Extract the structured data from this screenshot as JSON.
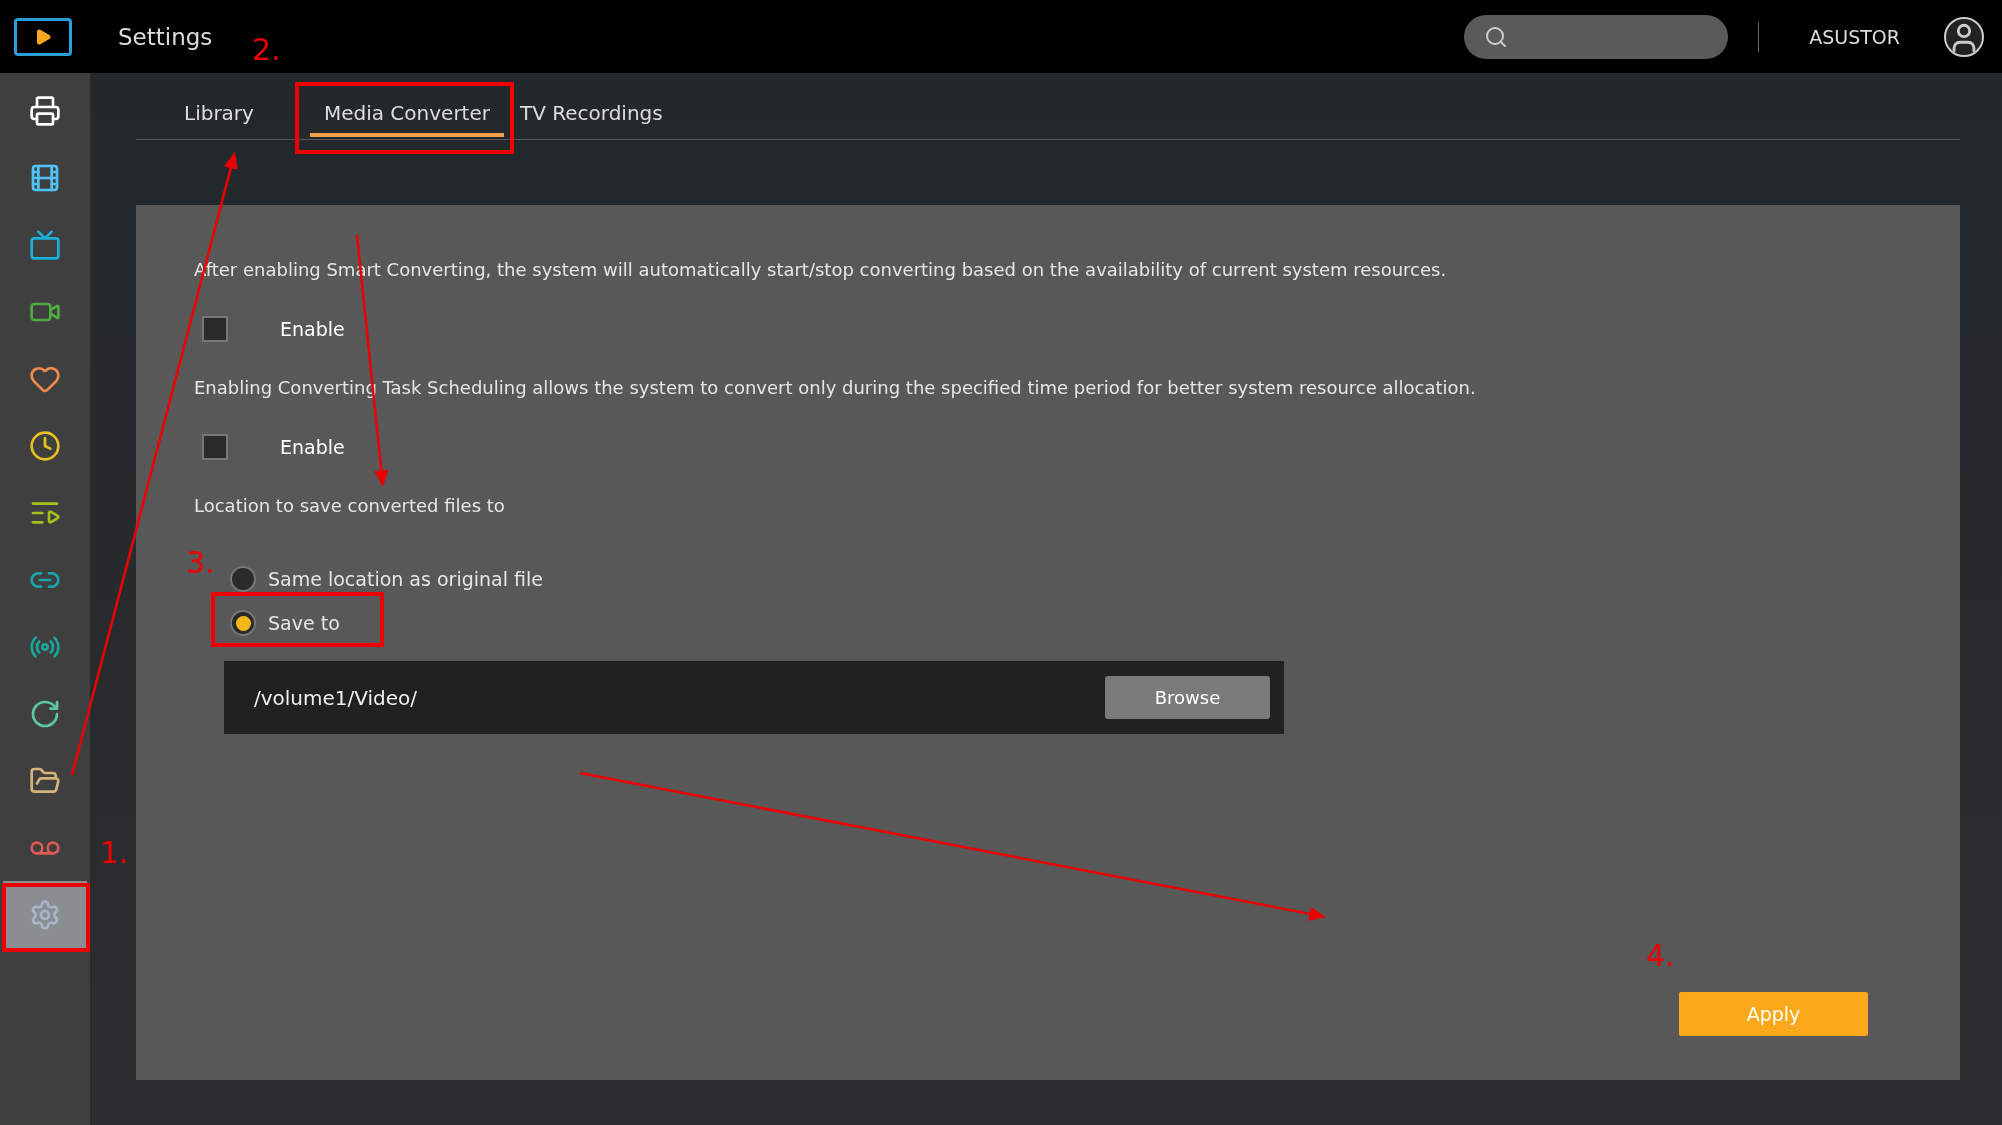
{
  "header": {
    "title": "Settings",
    "user": "ASUSTOR"
  },
  "sidebar": {
    "items": [
      {
        "selected": false
      },
      {
        "selected": false
      },
      {
        "selected": false
      },
      {
        "selected": false
      },
      {
        "selected": false
      },
      {
        "selected": false
      },
      {
        "selected": false
      },
      {
        "selected": false
      },
      {
        "selected": false
      },
      {
        "selected": false
      },
      {
        "selected": false
      },
      {
        "selected": false
      },
      {
        "selected": true
      }
    ]
  },
  "tabs": [
    {
      "label": "Library",
      "selected": false
    },
    {
      "label": "Media Converter",
      "selected": true
    },
    {
      "label": "TV Recordings",
      "selected": false
    }
  ],
  "panel": {
    "sections": [
      {
        "description": "After enabling Smart Converting, the system will automatically start/stop converting based on the availability of current system resources.",
        "checkbox": {
          "label": "Enable",
          "checked": false
        }
      },
      {
        "description": "Enabling Converting Task Scheduling allows the system to convert only during the specified time period for better system resource allocation.",
        "checkbox": {
          "label": "Enable",
          "checked": false
        }
      }
    ],
    "location": {
      "label": "Location to save converted files to",
      "options": [
        {
          "label": "Same location as original file",
          "selected": false
        },
        {
          "label": "Save to",
          "selected": true
        }
      ],
      "path": "/volume1/Video/",
      "browse": "Browse"
    },
    "apply": "Apply"
  },
  "annotations": {
    "step_labels": [
      "1.",
      "2.",
      "3.",
      "4."
    ]
  }
}
